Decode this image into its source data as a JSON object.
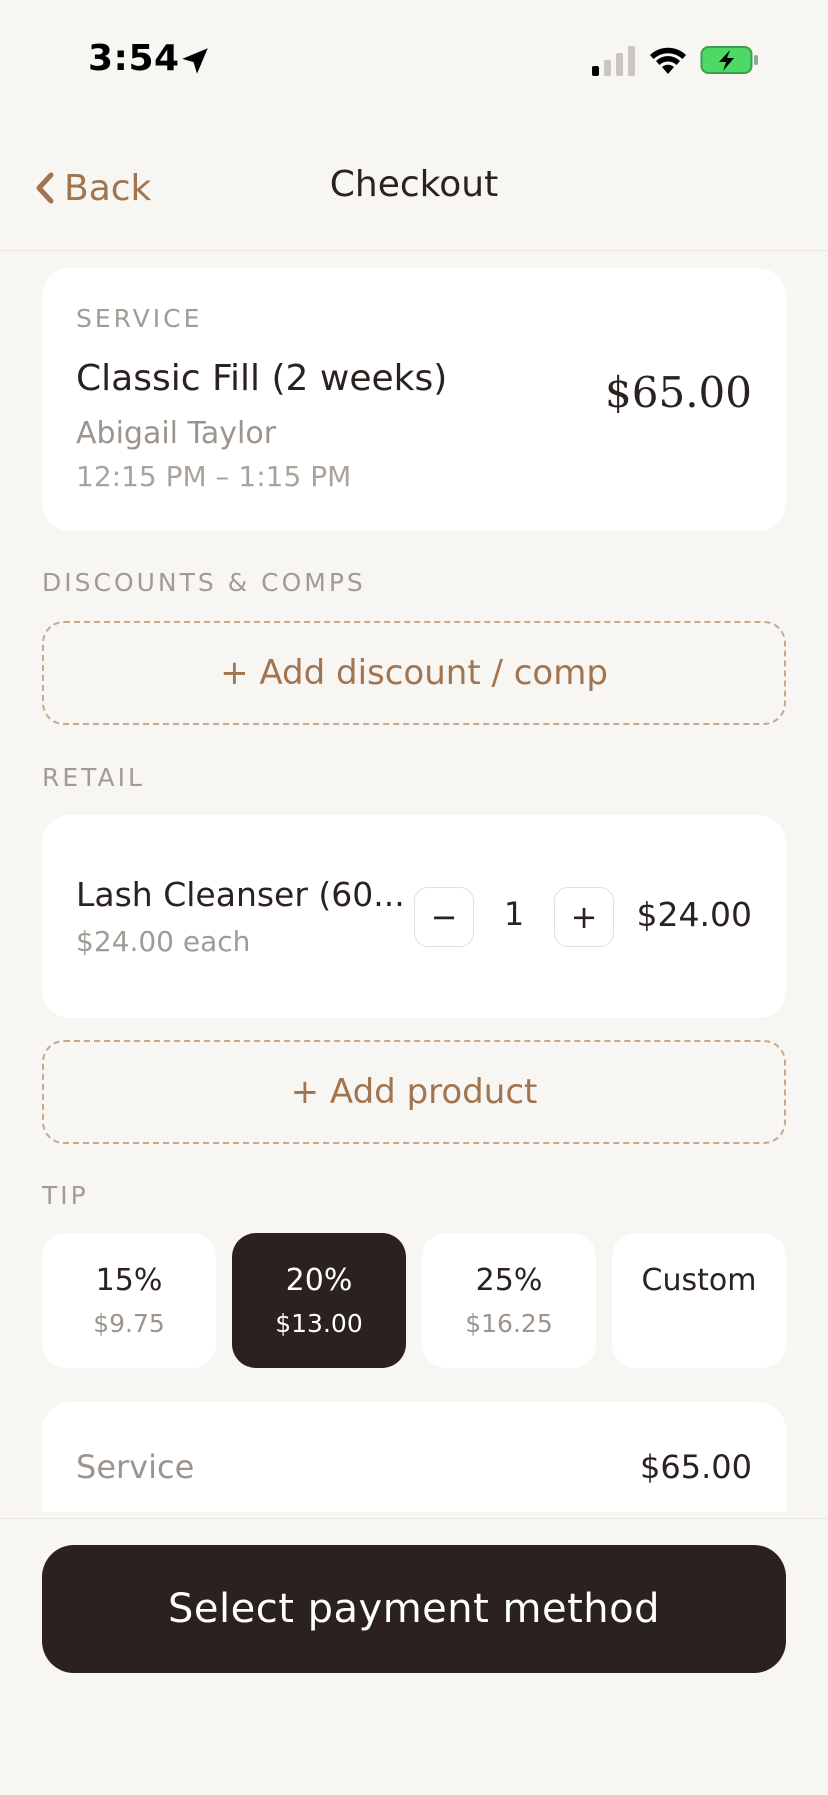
{
  "status_bar": {
    "time": "3:54",
    "icons": [
      "location-arrow-icon",
      "cellular-signal-icon",
      "wifi-icon",
      "battery-charging-icon"
    ]
  },
  "nav": {
    "back_label": "Back",
    "title": "Checkout"
  },
  "service": {
    "section_label": "SERVICE",
    "name": "Classic Fill (2 weeks)",
    "staff": "Abigail Taylor",
    "time_range": "12:15 PM – 1:15 PM",
    "price": "$65.00"
  },
  "discounts": {
    "section_label": "DISCOUNTS & COMPS",
    "add_label": "+ Add discount / comp"
  },
  "retail": {
    "section_label": "RETAIL",
    "items": [
      {
        "name": "Lash Cleanser (60...",
        "unit_price": "$24.00 each",
        "quantity": "1",
        "total": "$24.00"
      }
    ],
    "minus_symbol": "−",
    "plus_symbol": "+",
    "add_label": "+ Add product"
  },
  "tip": {
    "section_label": "TIP",
    "options": [
      {
        "percent": "15%",
        "amount": "$9.75",
        "selected": false
      },
      {
        "percent": "20%",
        "amount": "$13.00",
        "selected": true
      },
      {
        "percent": "25%",
        "amount": "$16.25",
        "selected": false
      },
      {
        "percent": "Custom",
        "amount": "",
        "selected": false
      }
    ]
  },
  "summary": {
    "rows": [
      {
        "label": "Service",
        "value": "$65.00"
      }
    ]
  },
  "footer": {
    "pay_label": "Select payment method"
  },
  "colors": {
    "accent": "#a07550",
    "dark": "#2b2220",
    "background": "#f8f6f3",
    "battery_green": "#4cd964"
  }
}
